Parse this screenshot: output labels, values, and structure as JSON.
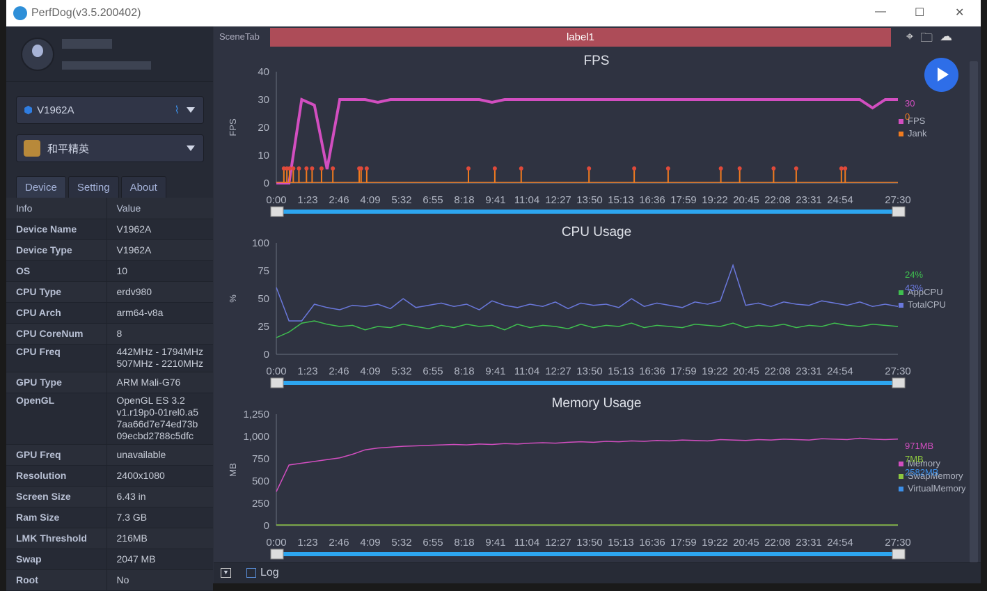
{
  "window": {
    "title": "PerfDog(v3.5.200402)"
  },
  "device": {
    "name": "V1962A"
  },
  "app": {
    "name": "和平精英"
  },
  "tabs": [
    "Device",
    "Setting",
    "About"
  ],
  "info_table": {
    "headers": [
      "Info",
      "Value"
    ],
    "rows": [
      [
        "Device Name",
        "V1962A"
      ],
      [
        "Device Type",
        "V1962A"
      ],
      [
        "OS",
        "10"
      ],
      [
        "CPU Type",
        "erdv980"
      ],
      [
        "CPU Arch",
        "arm64-v8a"
      ],
      [
        "CPU CoreNum",
        "8"
      ],
      [
        "CPU Freq",
        "442MHz - 1794MHz\n507MHz - 2210MHz"
      ],
      [
        "GPU Type",
        "ARM Mali-G76"
      ],
      [
        "OpenGL",
        "OpenGL ES 3.2\nv1.r19p0-01rel0.a5\n7aa66d7e74ed73b\n09ecbd2788c5dfc"
      ],
      [
        "GPU Freq",
        "unavailable"
      ],
      [
        "Resolution",
        "2400x1080"
      ],
      [
        "Screen Size",
        "6.43 in"
      ],
      [
        "Ram Size",
        "7.3 GB"
      ],
      [
        "LMK Threshold",
        "216MB"
      ],
      [
        "Swap",
        "2047 MB"
      ],
      [
        "Root",
        "No"
      ]
    ]
  },
  "scene": {
    "tab_label": "SceneTab",
    "label": "label1"
  },
  "bottom": {
    "log_label": "Log"
  },
  "x_ticks": [
    "0:00",
    "1:23",
    "2:46",
    "4:09",
    "5:32",
    "6:55",
    "8:18",
    "9:41",
    "11:04",
    "12:27",
    "13:50",
    "15:13",
    "16:36",
    "17:59",
    "19:22",
    "20:45",
    "22:08",
    "23:31",
    "24:54",
    "27:30"
  ],
  "chart_data": [
    {
      "type": "line",
      "title": "FPS",
      "ylabel": "FPS",
      "ylim": [
        0,
        40
      ],
      "yticks": [
        "0",
        "10",
        "20",
        "30",
        "40"
      ],
      "series": [
        {
          "name": "FPS",
          "color": "#d24ec0",
          "current": "30",
          "values": [
            0,
            0,
            30,
            28,
            5,
            30,
            30,
            30,
            29,
            30,
            30,
            30,
            30,
            30,
            30,
            30,
            30,
            29,
            30,
            30,
            30,
            30,
            30,
            30,
            30,
            30,
            30,
            30,
            30,
            30,
            30,
            30,
            30,
            30,
            30,
            30,
            30,
            30,
            30,
            30,
            30,
            30,
            30,
            30,
            30,
            30,
            30,
            27,
            30,
            30
          ]
        },
        {
          "name": "Jank",
          "color": "#f07b1f",
          "current": "0",
          "events_s": [
            20,
            28,
            35,
            45,
            60,
            80,
            95,
            120,
            150,
            220,
            225,
            240,
            510,
            580,
            650,
            830,
            950,
            1040,
            1180,
            1230,
            1320,
            1380,
            1500,
            1510
          ]
        }
      ]
    },
    {
      "type": "line",
      "title": "CPU Usage",
      "ylabel": "%",
      "ylim": [
        0,
        100
      ],
      "yticks": [
        "0",
        "25",
        "50",
        "75",
        "100"
      ],
      "series": [
        {
          "name": "AppCPU",
          "color": "#3fbf4f",
          "current": "24%",
          "values": [
            15,
            20,
            28,
            30,
            27,
            25,
            26,
            22,
            25,
            24,
            27,
            25,
            23,
            26,
            24,
            27,
            25,
            26,
            22,
            27,
            24,
            26,
            25,
            23,
            27,
            24,
            26,
            25,
            28,
            24,
            26,
            25,
            24,
            27,
            26,
            25,
            28,
            24,
            26,
            25,
            27,
            24,
            26,
            25,
            28,
            26,
            25,
            27,
            26,
            25
          ]
        },
        {
          "name": "TotalCPU",
          "color": "#6a78dc",
          "current": "43%",
          "values": [
            60,
            30,
            30,
            45,
            42,
            40,
            44,
            43,
            45,
            41,
            50,
            42,
            44,
            46,
            43,
            45,
            40,
            48,
            44,
            42,
            45,
            43,
            47,
            41,
            46,
            44,
            45,
            42,
            50,
            43,
            46,
            44,
            42,
            47,
            45,
            48,
            80,
            44,
            46,
            43,
            47,
            45,
            44,
            48,
            46,
            44,
            47,
            43,
            45,
            43
          ]
        }
      ]
    },
    {
      "type": "line",
      "title": "Memory Usage",
      "ylabel": "MB",
      "ylim": [
        0,
        1250
      ],
      "yticks": [
        "0",
        "250",
        "500",
        "750",
        "1,000",
        "1,250"
      ],
      "series": [
        {
          "name": "Memory",
          "color": "#d24ec0",
          "current": "971MB",
          "values": [
            380,
            680,
            700,
            720,
            740,
            760,
            800,
            850,
            870,
            880,
            890,
            895,
            900,
            905,
            910,
            905,
            915,
            910,
            920,
            915,
            925,
            930,
            925,
            935,
            940,
            935,
            945,
            940,
            950,
            945,
            955,
            950,
            960,
            955,
            950,
            965,
            960,
            955,
            965,
            960,
            970,
            965,
            960,
            975,
            970,
            965,
            980,
            970,
            965,
            971
          ]
        },
        {
          "name": "SwapMemory",
          "color": "#8cc63f",
          "current": "7MB",
          "values": [
            7,
            7,
            7,
            7,
            7,
            7,
            7,
            7,
            7,
            7,
            7,
            7,
            7,
            7,
            7,
            7,
            7,
            7,
            7,
            7,
            7,
            7,
            7,
            7,
            7,
            7,
            7,
            7,
            7,
            7,
            7,
            7,
            7,
            7,
            7,
            7,
            7,
            7,
            7,
            7,
            7,
            7,
            7,
            7,
            7,
            7,
            7,
            7,
            7,
            7
          ]
        },
        {
          "name": "VirtualMemory",
          "color": "#3c8fe8",
          "current": "2582MB",
          "values": []
        }
      ]
    }
  ],
  "x_range_s": [
    0,
    1650
  ]
}
